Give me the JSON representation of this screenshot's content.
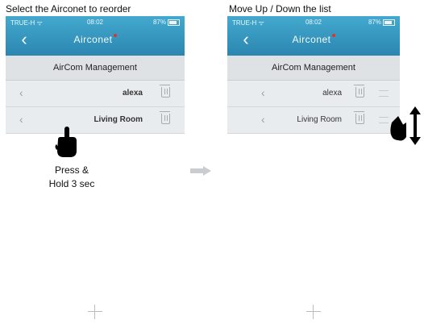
{
  "captions": {
    "left": "Select the Airconet to reorder",
    "right": "Move Up / Down the list"
  },
  "status_bar": {
    "carrier": "TRUE-H",
    "time": "08:02",
    "battery": "87%"
  },
  "app": {
    "brand": "Airconet",
    "screen_title": "AirCom Management"
  },
  "list_left": [
    {
      "label": "alexa"
    },
    {
      "label": "Living Room"
    }
  ],
  "list_right": [
    {
      "label": "alexa"
    },
    {
      "label": "Living Room"
    }
  ],
  "hint": {
    "line1": "Press &",
    "line2": "Hold 3 sec"
  },
  "icons": {
    "back": "chevron-left-icon",
    "row_chevron": "chevron-left-icon",
    "delete": "trash-icon",
    "reorder": "drag-handle-icon",
    "add": "plus-icon",
    "gesture_press": "pointing-hand-icon",
    "gesture_drag": "hand-up-down-icon",
    "flow": "right-arrow-icon"
  },
  "colors": {
    "header": "#2b86b0",
    "list_bg": "#e9ecef",
    "brand_dot": "#e0322a"
  }
}
